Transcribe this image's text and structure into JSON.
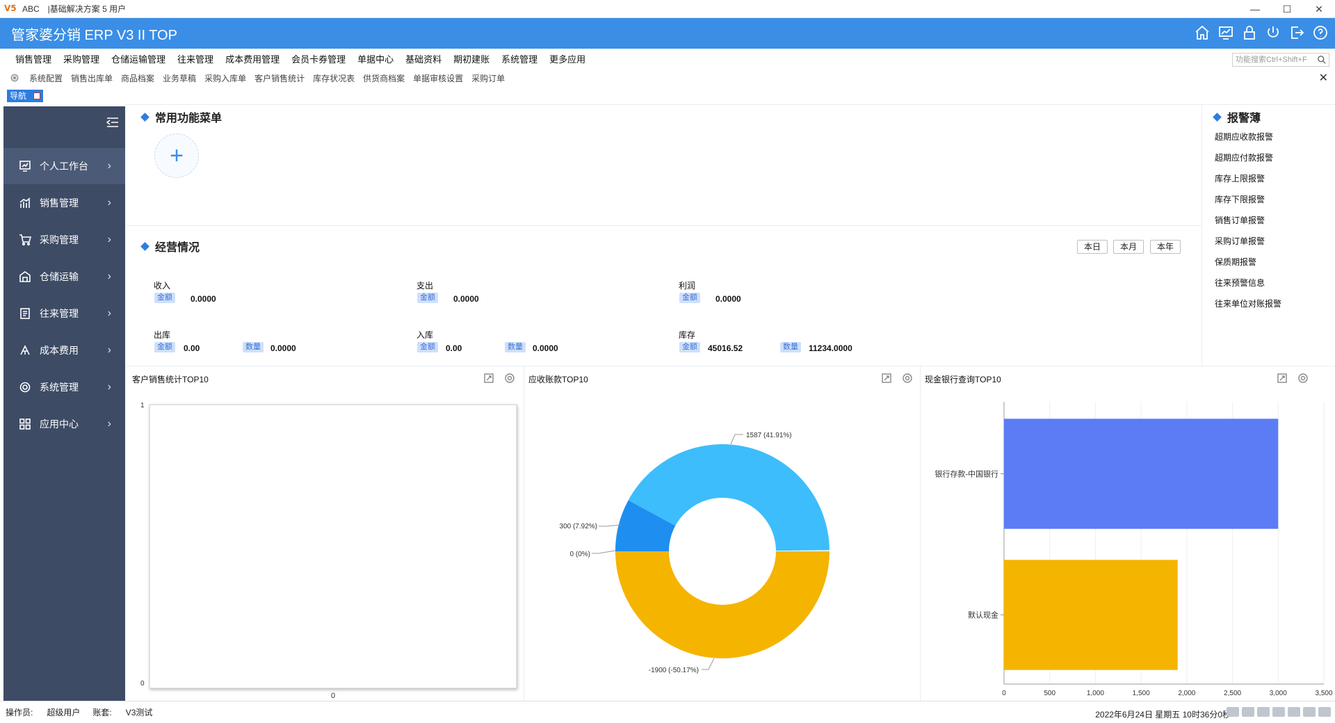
{
  "window": {
    "logo": "V5",
    "title": "ABC　|基础解决方案 5 用户",
    "min": "—",
    "max": "☐",
    "close": "✕"
  },
  "header": {
    "title": "管家婆分销 ERP V3 II TOP"
  },
  "menu": [
    "销售管理",
    "采购管理",
    "仓储运输管理",
    "往来管理",
    "成本费用管理",
    "会员卡券管理",
    "单据中心",
    "基础资料",
    "期初建账",
    "系统管理",
    "更多应用"
  ],
  "search": {
    "placeholder": "功能搜索Ctrl+Shift+F"
  },
  "quick": [
    "系统配置",
    "销售出库单",
    "商品档案",
    "业务草稿",
    "采购入库单",
    "客户销售统计",
    "库存状况表",
    "供货商档案",
    "单据审核设置",
    "采购订单"
  ],
  "nav_tab": "导航",
  "sidebar": [
    {
      "label": "个人工作台",
      "icon": "dashboard-icon"
    },
    {
      "label": "销售管理",
      "icon": "chart-icon"
    },
    {
      "label": "采购管理",
      "icon": "cart-icon"
    },
    {
      "label": "仓储运输",
      "icon": "warehouse-icon"
    },
    {
      "label": "往来管理",
      "icon": "document-icon"
    },
    {
      "label": "成本费用",
      "icon": "cost-icon"
    },
    {
      "label": "系统管理",
      "icon": "gear-icon"
    },
    {
      "label": "应用中心",
      "icon": "grid-icon"
    }
  ],
  "common_menu": {
    "title": "常用功能菜单",
    "add": "+"
  },
  "business": {
    "title": "经营情况",
    "periods": [
      "本日",
      "本月",
      "本年"
    ],
    "income": {
      "label": "收入",
      "tag": "金额",
      "amount": "0.0000"
    },
    "expense": {
      "label": "支出",
      "tag": "金额",
      "amount": "0.0000"
    },
    "profit": {
      "label": "利润",
      "tag": "金额",
      "amount": "0.0000"
    },
    "outbound": {
      "label": "出库",
      "tag_amount": "金额",
      "amount": "0.00",
      "tag_qty": "数量",
      "qty": "0.0000"
    },
    "inbound": {
      "label": "入库",
      "tag_amount": "金额",
      "amount": "0.00",
      "tag_qty": "数量",
      "qty": "0.0000"
    },
    "stock": {
      "label": "库存",
      "tag_amount": "金额",
      "amount": "45016.52",
      "tag_qty": "数量",
      "qty": "11234.0000"
    }
  },
  "alerts": {
    "title": "报警薄",
    "items": [
      "超期应收款报警",
      "超期应付款报警",
      "库存上限报警",
      "库存下限报警",
      "销售订单报警",
      "采购订单报警",
      "保质期报警",
      "往来预警信息",
      "往来单位对账报警"
    ]
  },
  "chart_data": [
    {
      "type": "bar",
      "title": "客户销售统计TOP10",
      "categories": [
        "0"
      ],
      "values": [],
      "ylim": [
        0,
        1
      ],
      "yticks": [
        "0",
        "1"
      ]
    },
    {
      "type": "pie",
      "title": "应收账款TOP10",
      "donut": true,
      "slices": [
        {
          "value": 1587,
          "label": "1587 (41.91%)",
          "color": "#3dbdfc"
        },
        {
          "value": 300,
          "label": "300 (7.92%)",
          "color": "#1e8ff0"
        },
        {
          "value": 0,
          "label": "0 (0%)",
          "color": "#1e8ff0"
        },
        {
          "value": -1900,
          "label": "-1900 (-50.17%)",
          "color": "#f5b400"
        }
      ]
    },
    {
      "type": "bar",
      "orientation": "horizontal",
      "title": "现金银行查询TOP10",
      "categories": [
        "银行存款-中国银行",
        "默认现金"
      ],
      "values": [
        3000,
        1900
      ],
      "colors": [
        "#5b7cf5",
        "#f5b400"
      ],
      "xlim": [
        0,
        3500
      ],
      "xticks": [
        "0",
        "500",
        "1,000",
        "1,500",
        "2,000",
        "2,500",
        "3,000",
        "3,500"
      ]
    }
  ],
  "status": {
    "operator_label": "操作员:",
    "operator": "超级用户",
    "account_label": "账套:",
    "account": "V3测试",
    "datetime": "2022年6月24日  星期五  10时36分0秒"
  }
}
